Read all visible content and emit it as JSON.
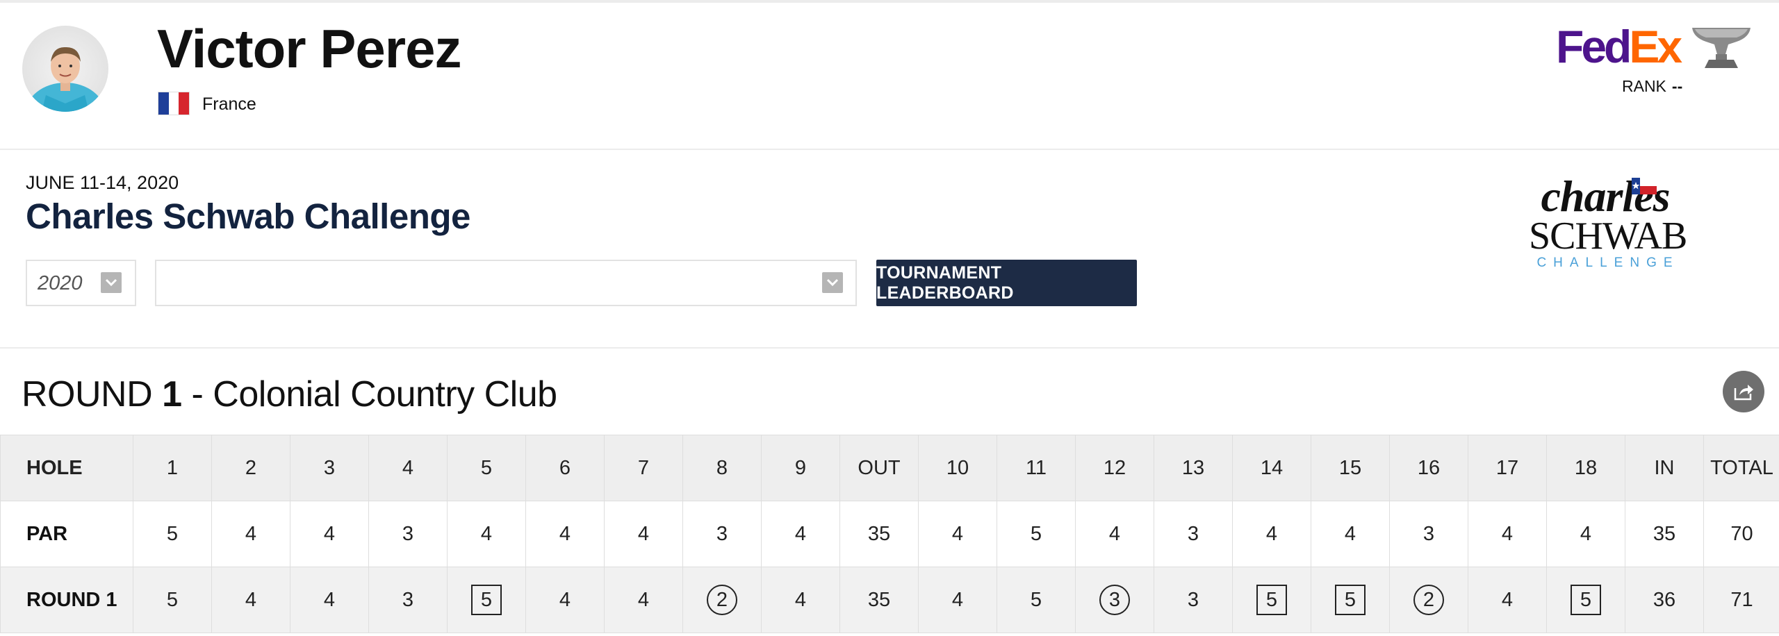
{
  "player": {
    "name": "Victor Perez",
    "country": "France",
    "flag_colors": [
      "#1f3f99",
      "#ffffff",
      "#d6262e"
    ]
  },
  "fedex": {
    "logo_fed": "Fed",
    "logo_ex": "Ex",
    "rank_label": "RANK",
    "rank_value": "--",
    "colors": {
      "fed": "#4d148c",
      "ex": "#ff6600"
    }
  },
  "tournament": {
    "dates": "JUNE 11-14, 2020",
    "name": "Charles Schwab Challenge",
    "year_select": "2020",
    "round_select": "",
    "leaderboard_button": "TOURNAMENT LEADERBOARD",
    "logo": {
      "line1": "charles",
      "line2": "SCHWAB",
      "line3": "CHALLENGE"
    }
  },
  "round": {
    "prefix": "ROUND",
    "number": "1",
    "course": "- Colonial Country Club"
  },
  "scorecard": {
    "columns": [
      "HOLE",
      "1",
      "2",
      "3",
      "4",
      "5",
      "6",
      "7",
      "8",
      "9",
      "OUT",
      "10",
      "11",
      "12",
      "13",
      "14",
      "15",
      "16",
      "17",
      "18",
      "IN",
      "TOTAL"
    ],
    "par": [
      "PAR",
      "5",
      "4",
      "4",
      "3",
      "4",
      "4",
      "4",
      "3",
      "4",
      "35",
      "4",
      "5",
      "4",
      "3",
      "4",
      "4",
      "3",
      "4",
      "4",
      "35",
      "70"
    ],
    "round1": [
      "ROUND 1",
      "5",
      "4",
      "4",
      "3",
      "5",
      "4",
      "4",
      "2",
      "4",
      "35",
      "4",
      "5",
      "3",
      "3",
      "5",
      "5",
      "2",
      "4",
      "5",
      "36",
      "71"
    ],
    "round1_marks": [
      "",
      "",
      "",
      "",
      "",
      "bogey",
      "",
      "",
      "birdie",
      "",
      "",
      "",
      "",
      "birdie",
      "",
      "bogey",
      "bogey",
      "birdie",
      "",
      "bogey",
      "",
      ""
    ]
  },
  "icons": {
    "avatar": "player-photo",
    "share": "share-icon",
    "dropdown": "chevron-down-icon",
    "trophy": "fedex-cup-trophy-icon"
  },
  "colors": {
    "navy": "#1d2b45",
    "title_navy": "#13233f",
    "row_gray": "#eeeeee",
    "challenge_blue": "#4aa0d8"
  }
}
